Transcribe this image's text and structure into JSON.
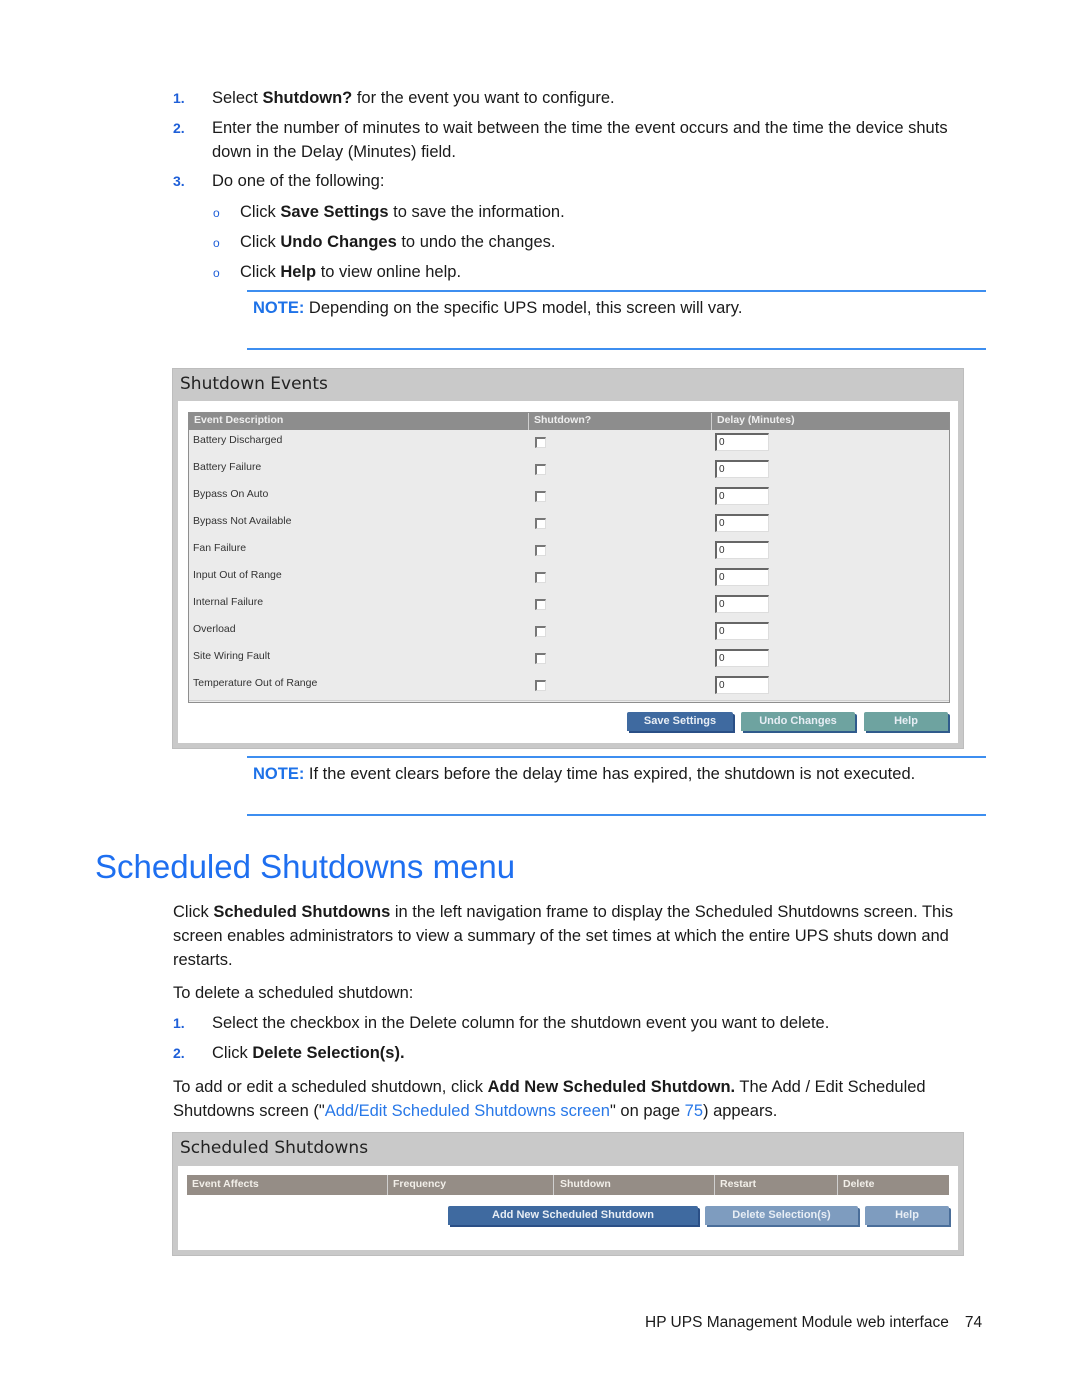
{
  "steps_top": [
    {
      "num": "1.",
      "pre": "Select ",
      "bold": "Shutdown?",
      "post": " for the event you want to configure."
    },
    {
      "num": "2.",
      "line1": "Enter the number of minutes to wait between the time the event occurs and the time the device shuts",
      "line2": "down in the Delay (Minutes) field."
    },
    {
      "num": "3.",
      "text": "Do one of the following:"
    }
  ],
  "sub_bullets": [
    {
      "bullet": "o",
      "pre": "Click ",
      "bold": "Save Settings",
      "post": " to save the information."
    },
    {
      "bullet": "o",
      "pre": "Click ",
      "bold": "Undo Changes",
      "post": " to undo the changes."
    },
    {
      "bullet": "o",
      "pre": "Click ",
      "bold": "Help",
      "post": " to view online help."
    }
  ],
  "note1": {
    "label": "NOTE:",
    "text": " Depending on the specific UPS model, this screen will vary."
  },
  "shutdown_events": {
    "title": "Shutdown Events",
    "columns": [
      "Event Description",
      "Shutdown?",
      "Delay (Minutes)"
    ],
    "rows": [
      {
        "event": "Battery Discharged",
        "shutdown": false,
        "delay": "0"
      },
      {
        "event": "Battery Failure",
        "shutdown": false,
        "delay": "0"
      },
      {
        "event": "Bypass On Auto",
        "shutdown": false,
        "delay": "0"
      },
      {
        "event": "Bypass Not Available",
        "shutdown": false,
        "delay": "0"
      },
      {
        "event": "Fan Failure",
        "shutdown": false,
        "delay": "0"
      },
      {
        "event": "Input Out of Range",
        "shutdown": false,
        "delay": "0"
      },
      {
        "event": "Internal Failure",
        "shutdown": false,
        "delay": "0"
      },
      {
        "event": "Overload",
        "shutdown": false,
        "delay": "0"
      },
      {
        "event": "Site Wiring Fault",
        "shutdown": false,
        "delay": "0"
      },
      {
        "event": "Temperature Out of Range",
        "shutdown": false,
        "delay": "0"
      }
    ],
    "buttons": {
      "save": "Save Settings",
      "undo": "Undo Changes",
      "help": "Help"
    }
  },
  "note2": {
    "label": "NOTE:",
    "text": " If the event clears before the delay time has expired, the shutdown is not executed."
  },
  "section_heading": "Scheduled Shutdowns menu",
  "intro": {
    "pre": "Click ",
    "bold": "Scheduled Shutdowns",
    "line1_post": " in the left navigation frame to display the Scheduled Shutdowns screen. This",
    "line2": "screen enables administrators to view a summary of the set times at which the entire UPS shuts down and",
    "line3": "restarts."
  },
  "delete_intro": "To delete a scheduled shutdown:",
  "delete_steps": [
    {
      "num": "1.",
      "text": "Select the checkbox in the Delete column for the shutdown event you want to delete."
    },
    {
      "num": "2.",
      "pre": "Click ",
      "bold": "Delete Selection(s)."
    }
  ],
  "add_para": {
    "pre": "To add or edit a scheduled shutdown, click ",
    "bold": "Add New Scheduled Shutdown.",
    "post": " The Add / Edit Scheduled",
    "line2_pre": "Shutdowns screen (\"",
    "link": "Add/Edit Scheduled Shutdowns screen",
    "line2_mid": "\" on page ",
    "page_link": "75",
    "line2_post": ") appears."
  },
  "scheduled_shutdowns": {
    "title": "Scheduled Shutdowns",
    "columns": [
      "Event Affects",
      "Frequency",
      "Shutdown",
      "Restart",
      "Delete"
    ],
    "buttons": {
      "add": "Add New Scheduled Shutdown",
      "delete": "Delete Selection(s)",
      "help": "Help"
    }
  },
  "footer": {
    "title": "HP UPS Management Module web interface",
    "page": "74"
  }
}
